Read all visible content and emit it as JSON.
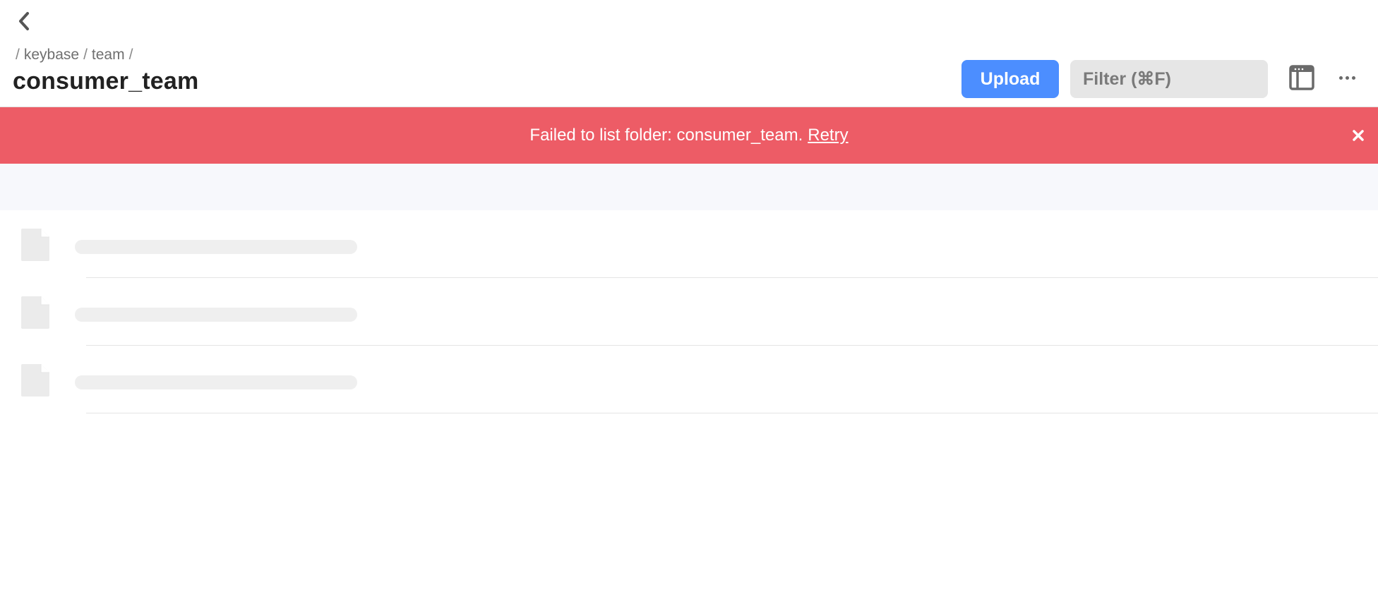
{
  "header": {
    "breadcrumb": [
      {
        "label": "keybase"
      },
      {
        "label": "team"
      }
    ],
    "breadcrumb_separator": "/",
    "title": "consumer_team",
    "upload_label": "Upload",
    "filter_placeholder": "Filter (⌘F)",
    "icons": {
      "back": "chevron-left-icon",
      "layout": "browser-window-icon",
      "more": "more-horizontal-icon"
    }
  },
  "error_banner": {
    "message": "Failed to list folder: consumer_team.",
    "retry_label": "Retry",
    "color": "#ed5c66"
  },
  "colors": {
    "accent": "#4c8eff",
    "placeholder": "#efefef",
    "band": "#f7f8fc"
  },
  "file_rows": [
    {
      "state": "loading"
    },
    {
      "state": "loading"
    },
    {
      "state": "loading"
    }
  ]
}
